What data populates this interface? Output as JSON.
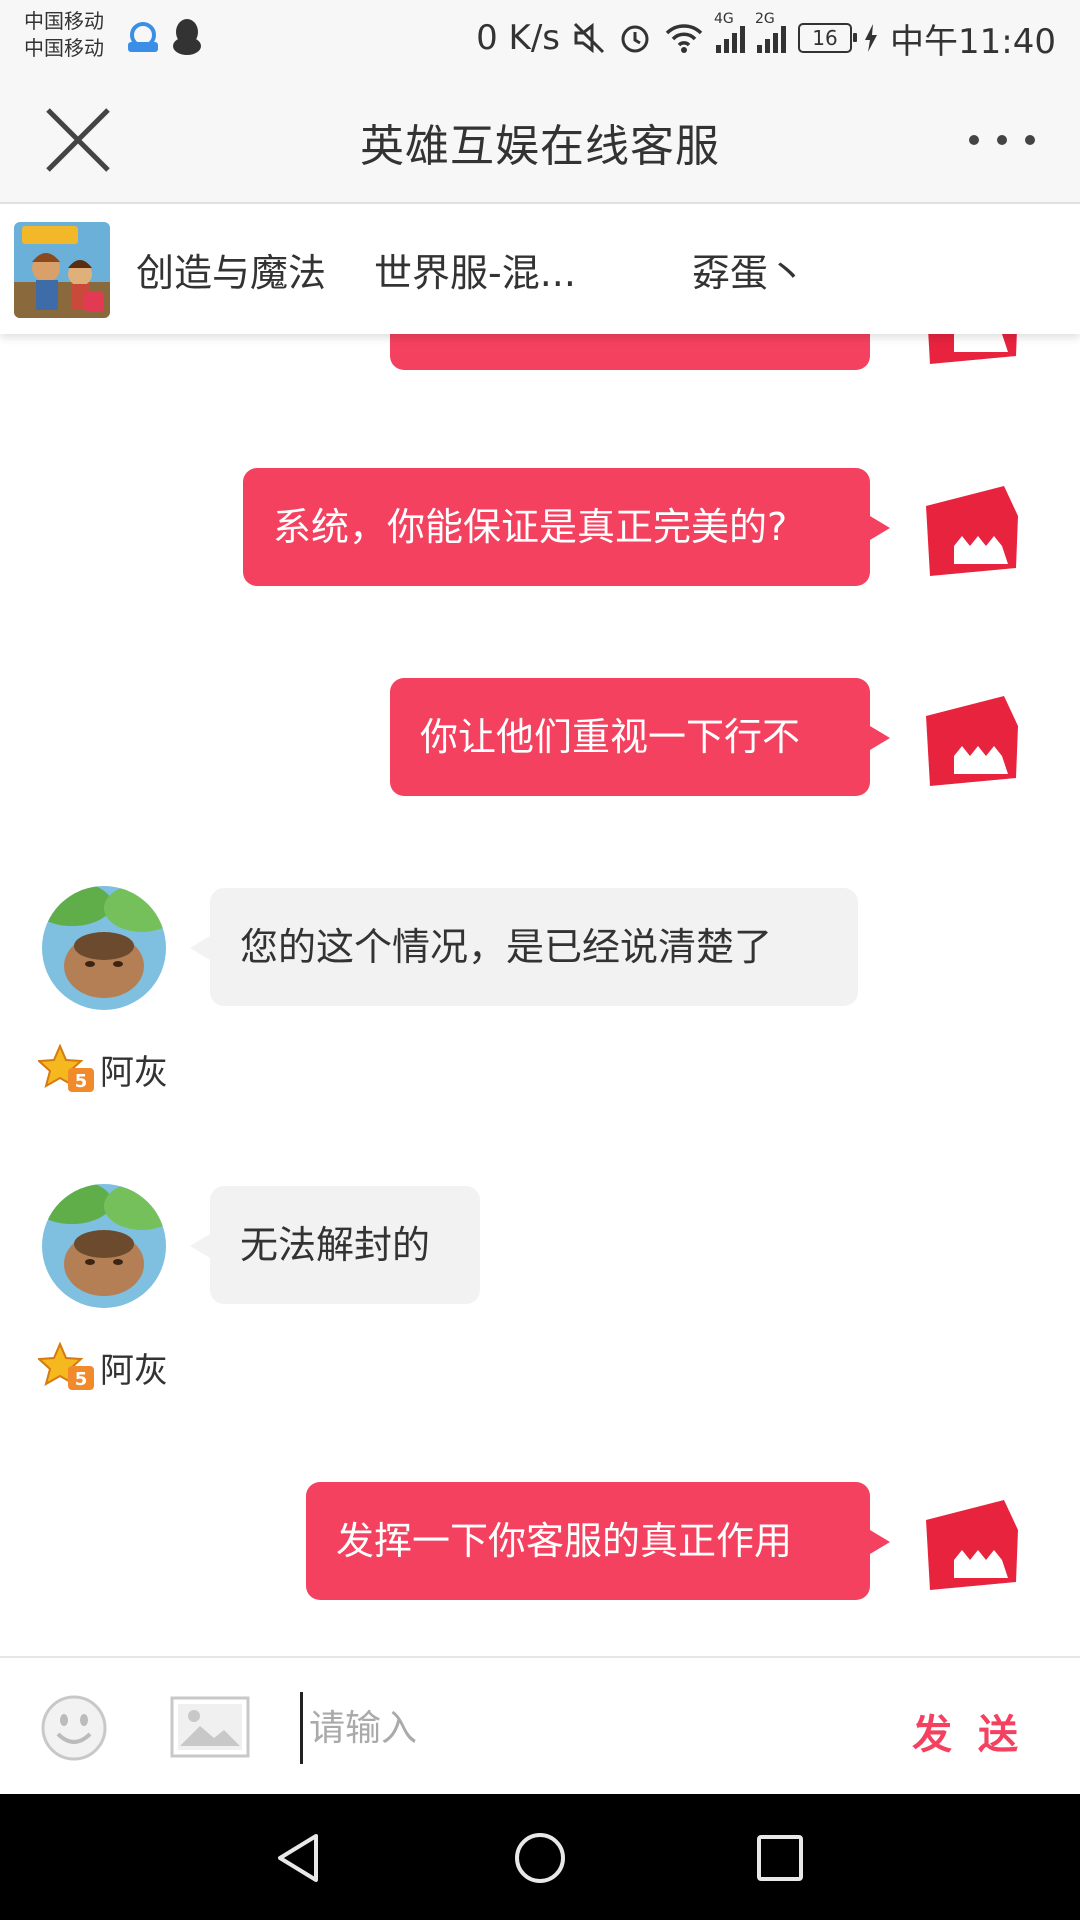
{
  "status_bar": {
    "carrier_1": "中国移动",
    "carrier_2": "中国移动",
    "net_speed": "0 K/s",
    "signal_1_label": "4G",
    "signal_2_label": "2G",
    "battery": "16",
    "time": "中午11:40"
  },
  "header": {
    "title": "英雄互娱在线客服"
  },
  "game_bar": {
    "game_name": "创造与魔法",
    "server": "世界服-混...",
    "player": "孬蛋丶"
  },
  "messages": [
    {
      "from": "me",
      "text": "系统，你能保证是真正完美的?"
    },
    {
      "from": "me",
      "text": "你让他们重视一下行不"
    },
    {
      "from": "agent",
      "text": "您的这个情况，是已经说清楚了",
      "agent_name": "阿灰"
    },
    {
      "from": "agent",
      "text": "无法解封的",
      "agent_name": "阿灰"
    },
    {
      "from": "me",
      "text": "发挥一下你客服的真正作用"
    }
  ],
  "input": {
    "placeholder": "请输入",
    "send_label": "发 送"
  },
  "colors": {
    "accent": "#f4415f",
    "incoming_bubble": "#f2f2f2",
    "header_bg": "#f7f7f7",
    "nav_bg": "#000000"
  },
  "icons": {
    "close": "close-icon",
    "more": "more-icon",
    "emoji": "emoji-icon",
    "image": "image-icon",
    "back": "back-icon",
    "home": "home-icon",
    "recent": "recent-apps-icon"
  }
}
